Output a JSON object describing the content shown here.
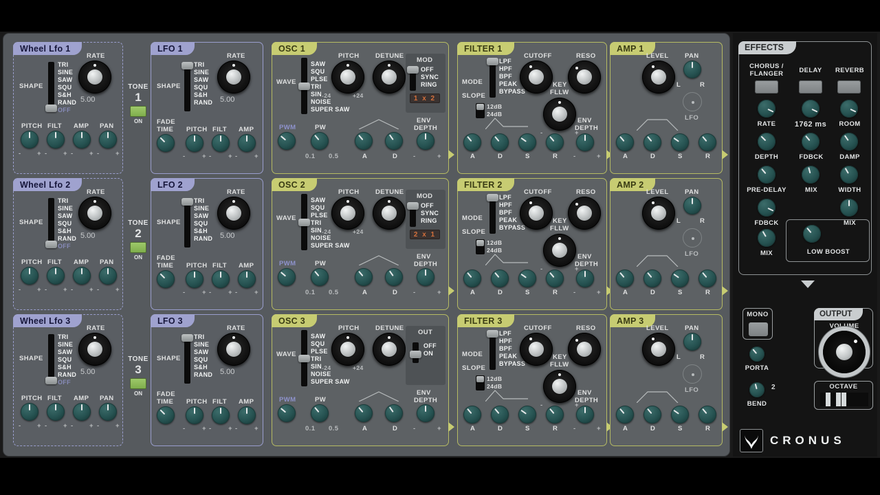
{
  "app": {
    "brand": "CRONUS"
  },
  "shape_options": [
    "TRI",
    "SINE",
    "SAW",
    "SQU",
    "S&H",
    "RAND",
    "OFF"
  ],
  "wave_options": [
    "SAW",
    "SQU",
    "PLSE",
    "TRI",
    "SIN",
    "NOISE",
    "SUPER SAW"
  ],
  "filter_mode_options": [
    "LPF",
    "HPF",
    "BPF",
    "PEAK",
    "BYPASS"
  ],
  "slope_options": [
    "12dB",
    "24dB"
  ],
  "mod_options": [
    "OFF",
    "SYNC",
    "RING"
  ],
  "out_options": [
    "OFF",
    "ON"
  ],
  "labels": {
    "shape": "SHAPE",
    "rate": "RATE",
    "pitch": "PITCH",
    "filt": "FILT",
    "amp": "AMP",
    "pan": "PAN",
    "fade_time_l1": "FADE",
    "fade_time_l2": "TIME",
    "wave": "WAVE",
    "detune": "DETUNE",
    "mod": "MOD",
    "out": "OUT",
    "pwm": "PWM",
    "pw": "PW",
    "env_depth_l1": "ENV",
    "env_depth_l2": "DEPTH",
    "a": "A",
    "d": "D",
    "s": "S",
    "r": "R",
    "mode": "MODE",
    "slope": "SLOPE",
    "cutoff": "CUTOFF",
    "reso": "RESO",
    "key_fllw_l1": "KEY",
    "key_fllw_l2": "FLLW",
    "level": "LEVEL",
    "lfo": "LFO",
    "l": "L",
    "rr": "R",
    "minus": "-",
    "plus": "+",
    "pitch_min": "-24",
    "pitch_max": "+24",
    "pw_min": "0.1",
    "pw_max": "0.5",
    "tone": "TONE",
    "on": "ON"
  },
  "voices": [
    {
      "wheel_lfo": {
        "title": "Wheel Lfo 1",
        "rate_value": "5.00",
        "shape_selected": "OFF"
      },
      "lfo": {
        "title": "LFO 1",
        "rate_value": "5.00",
        "shape_selected": "TRI"
      },
      "osc": {
        "title": "OSC 1",
        "wave_selected": "PLSE",
        "mod_selected": "OFF",
        "mod_display": "1 x 2",
        "has_mod": true
      },
      "filter": {
        "title": "FILTER 1",
        "mode_selected": "LPF",
        "slope_selected": "12dB"
      },
      "amp": {
        "title": "AMP 1"
      }
    },
    {
      "wheel_lfo": {
        "title": "Wheel Lfo 2",
        "rate_value": "5.00",
        "shape_selected": "OFF"
      },
      "lfo": {
        "title": "LFO 2",
        "rate_value": "5.00",
        "shape_selected": "TRI"
      },
      "osc": {
        "title": "OSC 2",
        "wave_selected": "PLSE",
        "mod_selected": "OFF",
        "mod_display": "2 x 1",
        "has_mod": true
      },
      "filter": {
        "title": "FILTER 2",
        "mode_selected": "LPF",
        "slope_selected": "12dB"
      },
      "amp": {
        "title": "AMP 2"
      }
    },
    {
      "wheel_lfo": {
        "title": "Wheel Lfo 3",
        "rate_value": "5.00",
        "shape_selected": "OFF"
      },
      "lfo": {
        "title": "LFO 3",
        "rate_value": "5.00",
        "shape_selected": "TRI"
      },
      "osc": {
        "title": "OSC 3",
        "wave_selected": "PLSE",
        "out_selected": "ON",
        "has_mod": false
      },
      "filter": {
        "title": "FILTER 3",
        "mode_selected": "LPF",
        "slope_selected": "12dB"
      },
      "amp": {
        "title": "AMP 3"
      }
    }
  ],
  "tones": [
    {
      "label": "TONE",
      "number": "1",
      "on_label": "ON",
      "enabled": true
    },
    {
      "label": "TONE",
      "number": "2",
      "on_label": "ON",
      "enabled": true
    },
    {
      "label": "TONE",
      "number": "3",
      "on_label": "ON",
      "enabled": true
    }
  ],
  "effects": {
    "title": "EFFECTS",
    "columns": [
      {
        "name_l1": "CHORUS /",
        "name_l2": "FLANGER",
        "knobs": [
          {
            "label": "RATE"
          },
          {
            "label": "DEPTH"
          },
          {
            "label": "PRE-DELAY"
          },
          {
            "label": "FDBCK"
          },
          {
            "label": "MIX"
          }
        ]
      },
      {
        "name_l1": "DELAY",
        "name_l2": "",
        "knobs": [
          {
            "label": "1762 ms"
          },
          {
            "label": "FDBCK"
          },
          {
            "label": "MIX"
          }
        ]
      },
      {
        "name_l1": "REVERB",
        "name_l2": "",
        "knobs": [
          {
            "label": "ROOM"
          },
          {
            "label": "DAMP"
          },
          {
            "label": "WIDTH"
          },
          {
            "label": "MIX"
          }
        ]
      }
    ],
    "low_boost_label": "LOW BOOST",
    "delay_time": "1762 ms"
  },
  "performance": {
    "mono_label": "MONO",
    "porta_label": "PORTA",
    "bend_label": "BEND",
    "bend_value": "2",
    "output_label": "OUTPUT",
    "volume_label": "VOLUME",
    "octave_label": "OCTAVE"
  },
  "colors": {
    "olive": "#c7cc72",
    "lilac": "#9fa2cf",
    "teal": "#2a5a58",
    "led_green": "#8fbd5c",
    "mod_orange": "#d4703c"
  }
}
